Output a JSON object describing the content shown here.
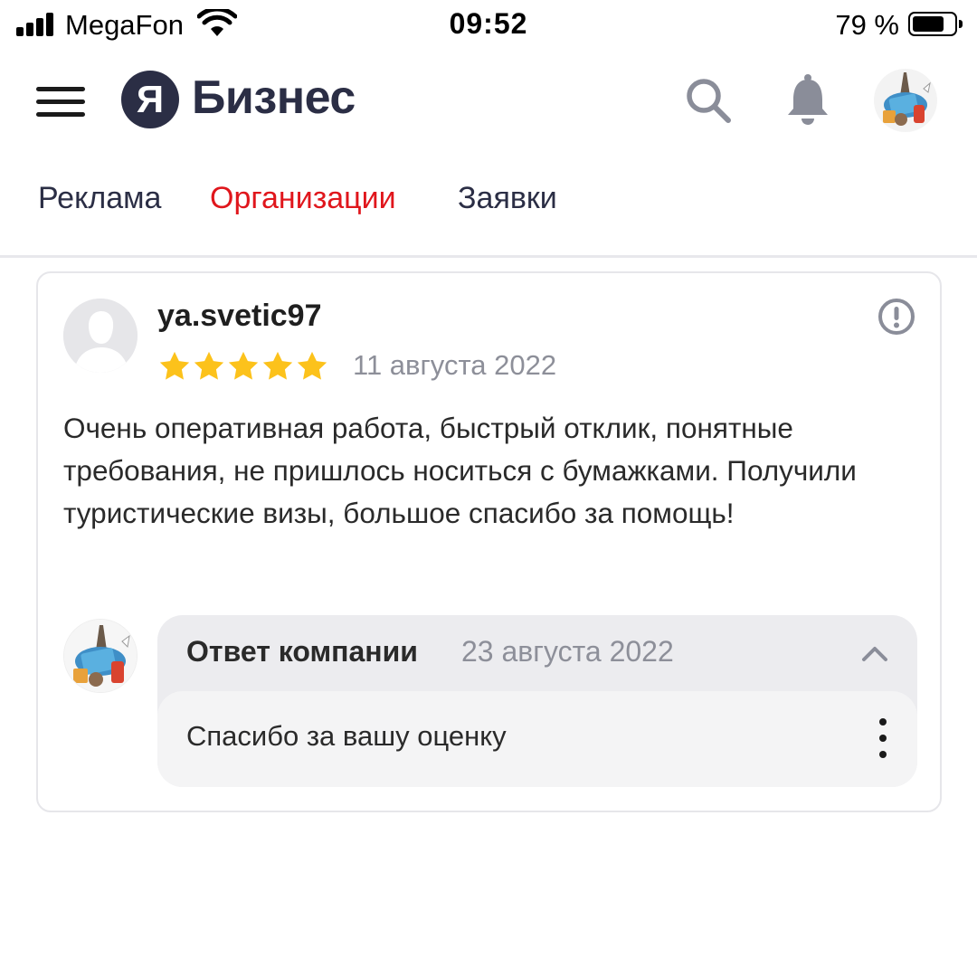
{
  "status_bar": {
    "carrier": "MegaFon",
    "time": "09:52",
    "battery_percent": "79 %",
    "battery_level": 0.79,
    "icons": [
      "signal-icon",
      "wifi-icon",
      "battery-icon"
    ]
  },
  "header": {
    "logo_letter": "Я",
    "logo_text": "Бизнес",
    "icons": [
      "menu-icon",
      "search-icon",
      "bell-icon",
      "avatar"
    ]
  },
  "tabs": [
    {
      "label": "Реклама",
      "active": false
    },
    {
      "label": "Организации",
      "active": true
    },
    {
      "label": "Заявки",
      "active": false
    }
  ],
  "review": {
    "author": "ya.svetic97",
    "rating": 5,
    "rating_max": 5,
    "date": "11 августа 2022",
    "text": "Очень оперативная работа, быстрый отклик, понятные требования, не пришлось носиться с бумажками. Получили туристические визы, большое спасибо за помощь!",
    "reply": {
      "title": "Ответ компании",
      "date": "23 августа 2022",
      "text": "Спасибо за вашу оценку"
    }
  },
  "colors": {
    "brand_dark": "#2b2e45",
    "accent_red": "#e0161c",
    "star_yellow": "#fcc21b",
    "muted_text": "#8d8f99",
    "reply_bg": "#ececef"
  }
}
